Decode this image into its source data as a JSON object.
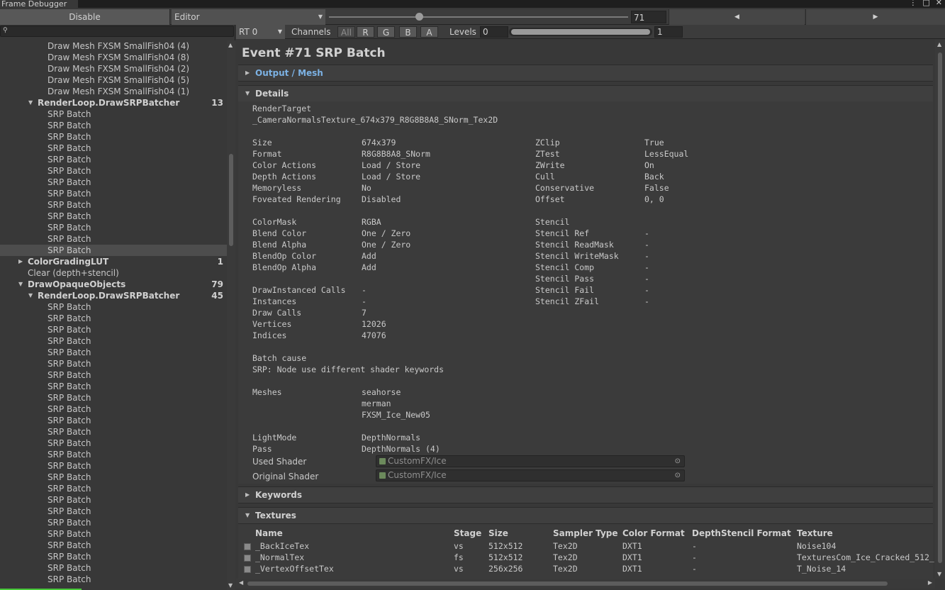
{
  "window": {
    "title": "Frame Debugger"
  },
  "toolbar": {
    "disable_label": "Disable",
    "target_select": "Editor",
    "event_number": "71",
    "event_slider": {
      "value": 71,
      "min": 1,
      "max": 234
    },
    "prev_icon": "triangle-left",
    "next_icon": "triangle-right"
  },
  "search": {
    "placeholder": ""
  },
  "tree": [
    {
      "label": "Draw Mesh FXSM SmallFish04 (4)",
      "indent": 67
    },
    {
      "label": "Draw Mesh FXSM SmallFish04 (8)",
      "indent": 67
    },
    {
      "label": "Draw Mesh FXSM SmallFish04 (2)",
      "indent": 67
    },
    {
      "label": "Draw Mesh FXSM SmallFish04 (5)",
      "indent": 67
    },
    {
      "label": "Draw Mesh FXSM SmallFish04 (1)",
      "indent": 67
    },
    {
      "label": "RenderLoop.DrawSRPBatcher",
      "indent": 53,
      "bold": true,
      "expanded": true,
      "count": "13"
    },
    {
      "label": "SRP Batch",
      "indent": 67
    },
    {
      "label": "SRP Batch",
      "indent": 67
    },
    {
      "label": "SRP Batch",
      "indent": 67
    },
    {
      "label": "SRP Batch",
      "indent": 67
    },
    {
      "label": "SRP Batch",
      "indent": 67
    },
    {
      "label": "SRP Batch",
      "indent": 67
    },
    {
      "label": "SRP Batch",
      "indent": 67
    },
    {
      "label": "SRP Batch",
      "indent": 67
    },
    {
      "label": "SRP Batch",
      "indent": 67
    },
    {
      "label": "SRP Batch",
      "indent": 67
    },
    {
      "label": "SRP Batch",
      "indent": 67
    },
    {
      "label": "SRP Batch",
      "indent": 67
    },
    {
      "label": "SRP Batch",
      "indent": 67,
      "selected": true
    },
    {
      "label": "ColorGradingLUT",
      "indent": 39,
      "bold": true,
      "collapsed": true,
      "count": "1"
    },
    {
      "label": "Clear (depth+stencil)",
      "indent": 39
    },
    {
      "label": "DrawOpaqueObjects",
      "indent": 39,
      "bold": true,
      "expanded": true,
      "count": "79"
    },
    {
      "label": "RenderLoop.DrawSRPBatcher",
      "indent": 53,
      "bold": true,
      "expanded": true,
      "count": "45"
    },
    {
      "label": "SRP Batch",
      "indent": 67
    },
    {
      "label": "SRP Batch",
      "indent": 67
    },
    {
      "label": "SRP Batch",
      "indent": 67
    },
    {
      "label": "SRP Batch",
      "indent": 67
    },
    {
      "label": "SRP Batch",
      "indent": 67
    },
    {
      "label": "SRP Batch",
      "indent": 67
    },
    {
      "label": "SRP Batch",
      "indent": 67
    },
    {
      "label": "SRP Batch",
      "indent": 67
    },
    {
      "label": "SRP Batch",
      "indent": 67
    },
    {
      "label": "SRP Batch",
      "indent": 67
    },
    {
      "label": "SRP Batch",
      "indent": 67
    },
    {
      "label": "SRP Batch",
      "indent": 67
    },
    {
      "label": "SRP Batch",
      "indent": 67
    },
    {
      "label": "SRP Batch",
      "indent": 67
    },
    {
      "label": "SRP Batch",
      "indent": 67
    },
    {
      "label": "SRP Batch",
      "indent": 67
    },
    {
      "label": "SRP Batch",
      "indent": 67
    },
    {
      "label": "SRP Batch",
      "indent": 67
    },
    {
      "label": "SRP Batch",
      "indent": 67
    },
    {
      "label": "SRP Batch",
      "indent": 67
    },
    {
      "label": "SRP Batch",
      "indent": 67
    },
    {
      "label": "SRP Batch",
      "indent": 67
    },
    {
      "label": "SRP Batch",
      "indent": 67
    },
    {
      "label": "SRP Batch",
      "indent": 67
    },
    {
      "label": "SRP Batch",
      "indent": 67
    }
  ],
  "right_toolbar": {
    "rt_select": "RT 0",
    "channels_label": "Channels",
    "channels": [
      "All",
      "R",
      "G",
      "B",
      "A"
    ],
    "levels_label": "Levels",
    "levels_min": "0",
    "levels_max": "1"
  },
  "event": {
    "title": "Event #71 SRP Batch",
    "foldouts": {
      "output_mesh": "Output / Mesh",
      "details": "Details",
      "keywords": "Keywords",
      "textures": "Textures"
    }
  },
  "details": {
    "render_target_label": "RenderTarget",
    "render_target_value": "_CameraNormalsTexture_674x379_R8G8B8A8_SNorm_Tex2D",
    "left_block1": [
      [
        "Size",
        "674x379"
      ],
      [
        "Format",
        "R8G8B8A8_SNorm"
      ],
      [
        "Color Actions",
        "Load / Store"
      ],
      [
        "Depth Actions",
        "Load / Store"
      ],
      [
        "Memoryless",
        "No"
      ],
      [
        "Foveated Rendering",
        "Disabled"
      ]
    ],
    "right_block1": [
      [
        "ZClip",
        "True"
      ],
      [
        "ZTest",
        "LessEqual"
      ],
      [
        "ZWrite",
        "On"
      ],
      [
        "Cull",
        "Back"
      ],
      [
        "Conservative",
        "False"
      ],
      [
        "Offset",
        "0, 0"
      ]
    ],
    "left_block2": [
      [
        "ColorMask",
        "RGBA"
      ],
      [
        "Blend Color",
        "One / Zero"
      ],
      [
        "Blend Alpha",
        "One / Zero"
      ],
      [
        "BlendOp Color",
        "Add"
      ],
      [
        "BlendOp Alpha",
        "Add"
      ]
    ],
    "right_block2": [
      [
        "Stencil",
        ""
      ],
      [
        "Stencil Ref",
        "-"
      ],
      [
        "Stencil ReadMask",
        "-"
      ],
      [
        "Stencil WriteMask",
        "-"
      ],
      [
        "Stencil Comp",
        "-"
      ],
      [
        "Stencil Pass",
        "-"
      ],
      [
        "Stencil Fail",
        "-"
      ],
      [
        "Stencil ZFail",
        "-"
      ]
    ],
    "left_block3": [
      [
        "DrawInstanced Calls",
        "-"
      ],
      [
        "Instances",
        "-"
      ],
      [
        "Draw Calls",
        "7"
      ],
      [
        "Vertices",
        "12026"
      ],
      [
        "Indices",
        "47076"
      ]
    ],
    "batch_cause_label": "Batch cause",
    "batch_cause_value": "SRP: Node use different shader keywords",
    "meshes_label": "Meshes",
    "meshes": [
      "seahorse",
      "merman",
      "FXSM_Ice_New05"
    ],
    "lightmode_label": "LightMode",
    "lightmode_value": "DepthNormals",
    "pass_label": "Pass",
    "pass_value": "DepthNormals (4)",
    "used_shader_label": "Used Shader",
    "used_shader_value": "CustomFX/Ice",
    "original_shader_label": "Original Shader",
    "original_shader_value": "CustomFX/Ice"
  },
  "textures": {
    "headers": [
      "Name",
      "Stage",
      "Size",
      "Sampler Type",
      "Color Format",
      "DepthStencil Format",
      "Texture"
    ],
    "rows": [
      [
        "_BackIceTex",
        "vs",
        "512x512",
        "Tex2D",
        "DXT1",
        "-",
        "Noise104"
      ],
      [
        "_NormalTex",
        "fs",
        "512x512",
        "Tex2D",
        "DXT1",
        "-",
        "TexturesCom_Ice_Cracked_512_"
      ],
      [
        "_VertexOffsetTex",
        "vs",
        "256x256",
        "Tex2D",
        "DXT1",
        "-",
        "T_Noise_14"
      ]
    ]
  },
  "colors": {
    "background": "#383838",
    "panel": "#3b3b3b",
    "link": "#7cb2e4",
    "progress": "#48c93a"
  }
}
